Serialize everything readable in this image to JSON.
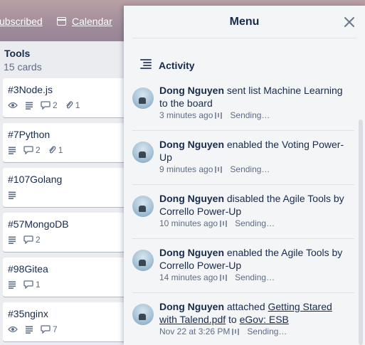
{
  "board": {
    "header": {
      "subscribed_label": "ubscribed",
      "calendar_label": "Calendar"
    },
    "list": {
      "title": "Tools",
      "count": "15 cards",
      "cards": [
        {
          "title": "#3Node.js",
          "badges": {
            "watch": true,
            "description": true,
            "comments": "2",
            "attachments": "1"
          }
        },
        {
          "title": "#7Python",
          "badges": {
            "watch": false,
            "description": true,
            "comments": "2",
            "attachments": "1"
          }
        },
        {
          "title": "#107Golang",
          "badges": {
            "watch": false,
            "description": true,
            "comments": null,
            "attachments": null
          }
        },
        {
          "title": "#57MongoDB",
          "badges": {
            "watch": false,
            "description": true,
            "comments": "2",
            "attachments": null
          }
        },
        {
          "title": "#98Gitea",
          "badges": {
            "watch": false,
            "description": true,
            "comments": "1",
            "attachments": null
          }
        },
        {
          "title": "#35nginx",
          "badges": {
            "watch": true,
            "description": true,
            "comments": "7",
            "attachments": null
          }
        }
      ]
    }
  },
  "menu": {
    "title": "Menu",
    "close_icon": "close-icon",
    "section_title": "Activity",
    "activities": [
      {
        "user": "Dong Nguyen",
        "text": " sent list Machine Learning to the board",
        "time": "3 minutes ago",
        "status": "Sending…"
      },
      {
        "user": "Dong Nguyen",
        "text": " enabled the Voting Power-Up",
        "time": "9 minutes ago",
        "status": "Sending…"
      },
      {
        "user": "Dong Nguyen",
        "text": " disabled the Agile Tools by Corrello Power-Up",
        "time": "10 minutes ago",
        "status": "Sending…"
      },
      {
        "user": "Dong Nguyen",
        "text": " enabled the Agile Tools by Corrello Power-Up",
        "time": "14 minutes ago",
        "status": "Sending…"
      },
      {
        "user": "Dong Nguyen",
        "text_before": " attached ",
        "link1": "Getting Stared with Talend.pdf",
        "text_mid": " to ",
        "link2": "eGov: ESB",
        "time": "Nov 22 at 3:26 PM",
        "status": "Sending…"
      }
    ]
  },
  "colors": {
    "list_bg": "#ebecf0",
    "card_bg": "#ffffff",
    "menu_bg": "#f4f5f7",
    "text": "#172b4d",
    "muted": "#5e6c84"
  }
}
